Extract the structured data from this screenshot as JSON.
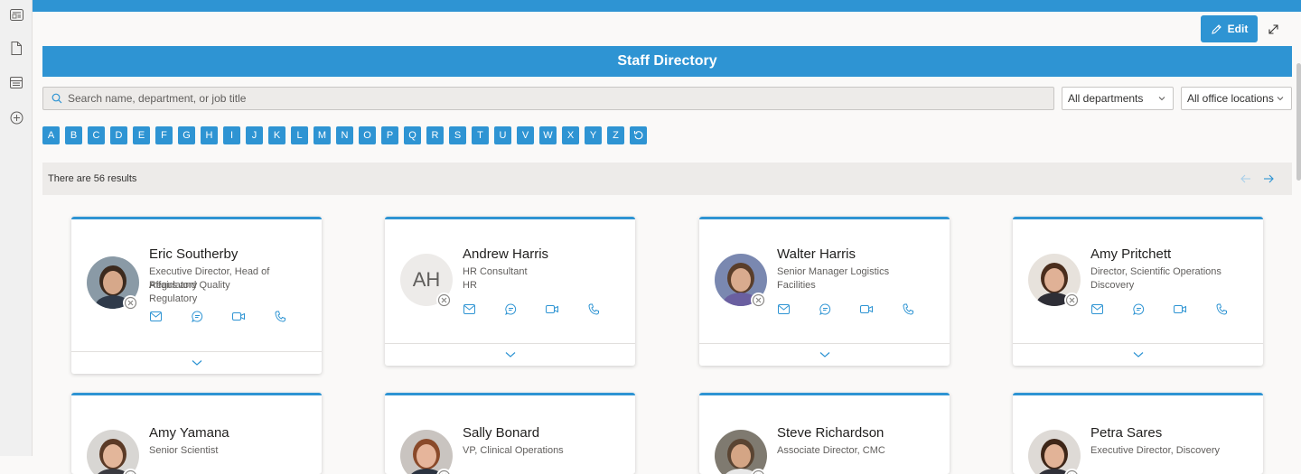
{
  "app": {
    "edit_label": "Edit",
    "accent_color": "#2e94d3"
  },
  "rail": {
    "icons": [
      "news-icon",
      "document-icon",
      "list-icon",
      "add-circle-icon"
    ]
  },
  "directory": {
    "title": "Staff Directory",
    "search_placeholder": "Search name, department, or job title",
    "department_filter": "All departments",
    "location_filter": "All office locations",
    "letters": [
      "A",
      "B",
      "C",
      "D",
      "E",
      "F",
      "G",
      "H",
      "I",
      "J",
      "K",
      "L",
      "M",
      "N",
      "O",
      "P",
      "Q",
      "R",
      "S",
      "T",
      "U",
      "V",
      "W",
      "X",
      "Y",
      "Z"
    ],
    "results_text": "There are 56 results"
  },
  "people": [
    {
      "name": "Eric Southerby",
      "title_line1": "Executive Director, Head of Regulatory",
      "title_line2": "Affairs and Quality",
      "department": "Regulatory",
      "initials": ""
    },
    {
      "name": "Andrew Harris",
      "title_line1": "HR Consultant",
      "title_line2": "",
      "department": "HR",
      "initials": "AH"
    },
    {
      "name": "Walter Harris",
      "title_line1": "Senior Manager Logistics",
      "title_line2": "",
      "department": "Facilities",
      "initials": ""
    },
    {
      "name": "Amy Pritchett",
      "title_line1": "Director, Scientific Operations",
      "title_line2": "",
      "department": "Discovery",
      "initials": ""
    },
    {
      "name": "Amy Yamana",
      "title_line1": "Senior Scientist",
      "title_line2": "",
      "department": "",
      "initials": ""
    },
    {
      "name": "Sally Bonard",
      "title_line1": "VP, Clinical Operations",
      "title_line2": "",
      "department": "",
      "initials": ""
    },
    {
      "name": "Steve Richardson",
      "title_line1": "Associate Director, CMC",
      "title_line2": "",
      "department": "",
      "initials": ""
    },
    {
      "name": "Petra Sares",
      "title_line1": "Executive Director, Discovery",
      "title_line2": "",
      "department": "",
      "initials": ""
    }
  ]
}
